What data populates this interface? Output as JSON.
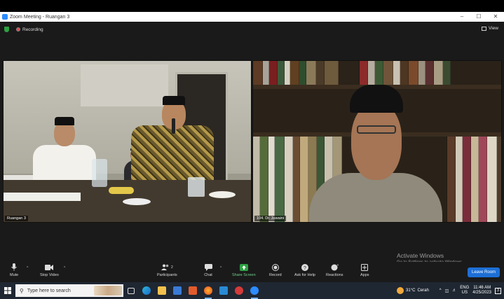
{
  "window": {
    "title": "Zoom Meeting - Ruangan 3",
    "minimize": "–",
    "maximize": "☐",
    "close": "✕"
  },
  "meeting": {
    "recording_label": "Recording",
    "view_label": "View"
  },
  "participants": [
    {
      "name": "Ruangan 3"
    },
    {
      "name": "104. Dr. Juwaini"
    }
  ],
  "toolbar": {
    "mute": "Mute",
    "stop_video": "Stop Video",
    "participants": "Participants",
    "participants_count": "2",
    "chat": "Chat",
    "share_screen": "Share Screen",
    "record": "Record",
    "ask_for_help": "Ask for Help",
    "reactions": "Reactions",
    "apps": "Apps",
    "leave_room": "Leave Room",
    "accent_share": "#2ea043",
    "leave_color": "#e02828"
  },
  "watermark": {
    "line1": "Activate Windows",
    "line2": "Go to Settings to activate Windows."
  },
  "taskbar": {
    "search_placeholder": "Type here to search",
    "weather_temp": "31°C",
    "weather_text": "Cerah",
    "lang_line1": "ENG",
    "lang_line2": "US",
    "time": "11:46 AM",
    "date": "4/25/2023",
    "notification_count": "3",
    "tray_chevron": "^"
  }
}
